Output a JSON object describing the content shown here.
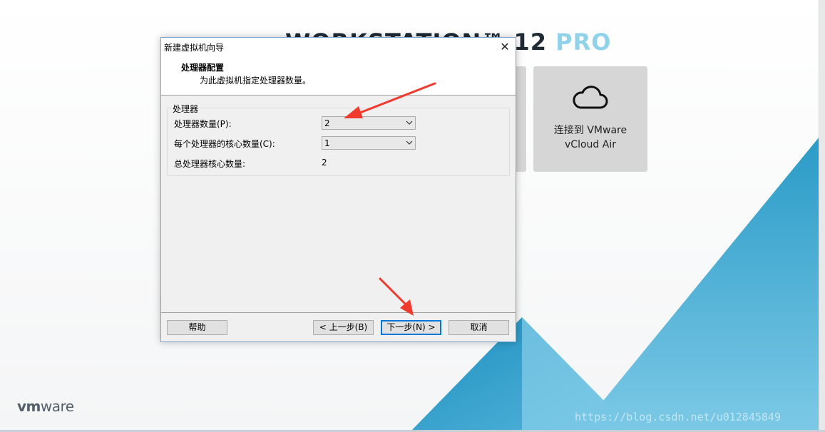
{
  "background": {
    "title_main": "WORKSTATION™ 12",
    "title_pro": "PRO",
    "logo_vm": "vm",
    "logo_ware": "ware",
    "watermark": "https://blog.csdn.net/u012845849",
    "accent_color": "#3aa6cf"
  },
  "tiles": {
    "cloud": {
      "icon": "cloud-icon",
      "line1": "连接到 VMware",
      "line2": "vCloud Air"
    }
  },
  "dialog": {
    "title": "新建虚拟机向导",
    "close_glyph": "✕",
    "header_title": "处理器配置",
    "header_subtitle": "为此虚拟机指定处理器数量。",
    "group_caption": "处理器",
    "processor_count": {
      "label": "处理器数量(P):",
      "value": "2"
    },
    "cores_per_processor": {
      "label": "每个处理器的核心数量(C):",
      "value": "1"
    },
    "total_cores": {
      "label": "总处理器核心数量:",
      "value": "2"
    },
    "buttons": {
      "help": "帮助",
      "back": "< 上一步(B)",
      "next": "下一步(N) >",
      "cancel": "取消"
    }
  },
  "annotations": {
    "arrow_color": "#f03a2e"
  }
}
